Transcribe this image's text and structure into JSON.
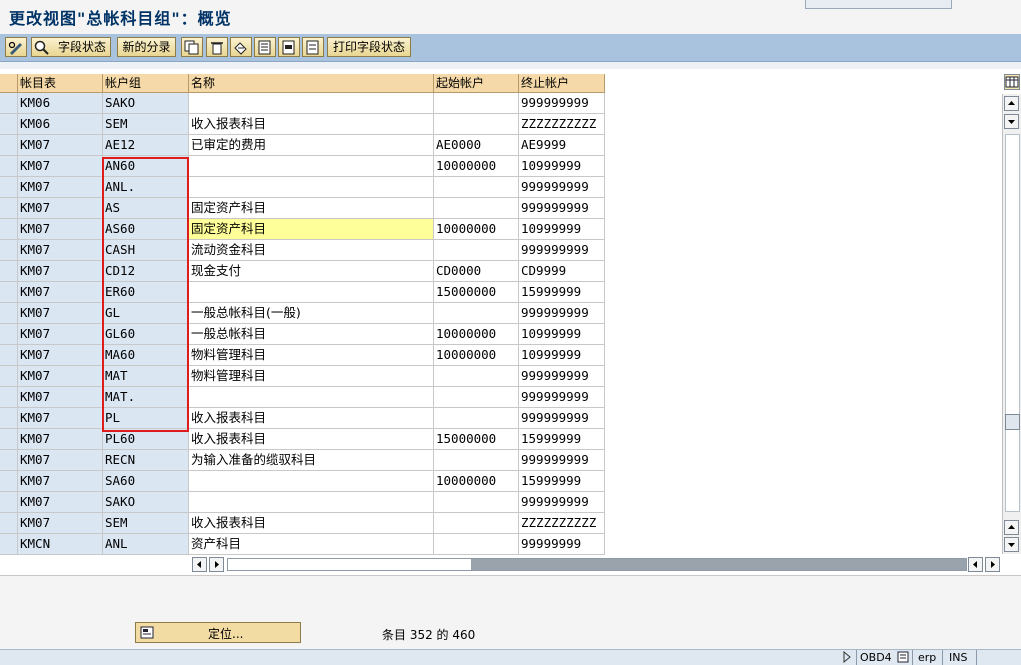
{
  "title": "更改视图\"总帐科目组\"：概览",
  "toolbar": {
    "field_status": "字段状态",
    "new_entries": "新的分录",
    "print_field_status": "打印字段状态"
  },
  "columns": [
    "帐目表",
    "帐户组",
    "名称",
    "起始帐户",
    "终止帐户"
  ],
  "rows": [
    {
      "chart": "KM06",
      "group": "SAKO",
      "name": "",
      "from": "",
      "to": "999999999"
    },
    {
      "chart": "KM06",
      "group": "SEM",
      "name": "收入报表科目",
      "from": "",
      "to": "ZZZZZZZZZZ"
    },
    {
      "chart": "KM07",
      "group": "AE12",
      "name": "已审定的费用",
      "from": "AE0000",
      "to": "AE9999"
    },
    {
      "chart": "KM07",
      "group": "AN60",
      "name": "",
      "from": "10000000",
      "to": "10999999"
    },
    {
      "chart": "KM07",
      "group": "ANL.",
      "name": "",
      "from": "",
      "to": "999999999"
    },
    {
      "chart": "KM07",
      "group": "AS",
      "name": "固定资产科目",
      "from": "",
      "to": "999999999"
    },
    {
      "chart": "KM07",
      "group": "AS60",
      "name": "固定资产科目",
      "from": "10000000",
      "to": "10999999"
    },
    {
      "chart": "KM07",
      "group": "CASH",
      "name": "流动资金科目",
      "from": "",
      "to": "999999999"
    },
    {
      "chart": "KM07",
      "group": "CD12",
      "name": "现金支付",
      "from": "CD0000",
      "to": "CD9999"
    },
    {
      "chart": "KM07",
      "group": "ER60",
      "name": "",
      "from": "15000000",
      "to": "15999999"
    },
    {
      "chart": "KM07",
      "group": "GL",
      "name": "一般总帐科目(一般)",
      "from": "",
      "to": "999999999"
    },
    {
      "chart": "KM07",
      "group": "GL60",
      "name": "一般总帐科目",
      "from": "10000000",
      "to": "10999999"
    },
    {
      "chart": "KM07",
      "group": "MA60",
      "name": "物料管理科目",
      "from": "10000000",
      "to": "10999999"
    },
    {
      "chart": "KM07",
      "group": "MAT",
      "name": "物料管理科目",
      "from": "",
      "to": "999999999"
    },
    {
      "chart": "KM07",
      "group": "MAT.",
      "name": "",
      "from": "",
      "to": "999999999"
    },
    {
      "chart": "KM07",
      "group": "PL",
      "name": "收入报表科目",
      "from": "",
      "to": "999999999"
    },
    {
      "chart": "KM07",
      "group": "PL60",
      "name": "收入报表科目",
      "from": "15000000",
      "to": "15999999"
    },
    {
      "chart": "KM07",
      "group": "RECN",
      "name": "为输入准备的缆驭科目",
      "from": "",
      "to": "999999999"
    },
    {
      "chart": "KM07",
      "group": "SA60",
      "name": "",
      "from": "10000000",
      "to": "15999999"
    },
    {
      "chart": "KM07",
      "group": "SAKO",
      "name": "",
      "from": "",
      "to": "999999999"
    },
    {
      "chart": "KM07",
      "group": "SEM",
      "name": "收入报表科目",
      "from": "",
      "to": "ZZZZZZZZZZ"
    },
    {
      "chart": "KMCN",
      "group": "ANL",
      "name": "资产科目",
      "from": "",
      "to": "99999999"
    }
  ],
  "highlighted_row": 6,
  "locate_button": "定位...",
  "entry_info": "条目 352 的 460",
  "status_bar": {
    "transaction": "OBD4",
    "client": "erp",
    "mode": "INS"
  },
  "colors": {
    "toolbar": "#a9c3df",
    "header": "#f5d9a8",
    "key_column": "#dbe6f3",
    "highlight": "#ffff99",
    "annotation_box": "#e01b1b"
  }
}
